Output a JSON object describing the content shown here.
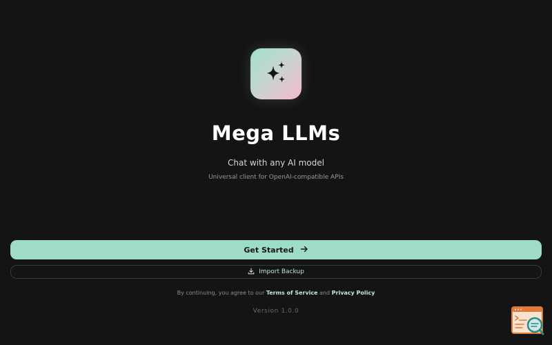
{
  "app": {
    "title": "Mega LLMs",
    "tagline": "Chat with any AI model",
    "subtagline": "Universal client for OpenAI-compatible APIs",
    "logo_icon": "sparkles-icon"
  },
  "actions": {
    "get_started_label": "Get Started",
    "get_started_icon": "arrow-right-icon",
    "import_backup_label": "Import Backup",
    "import_backup_icon": "download-icon"
  },
  "legal": {
    "prefix": "By continuing, you agree to our",
    "terms_label": "Terms of Service",
    "joiner": "and",
    "privacy_label": "Privacy Policy"
  },
  "footer": {
    "version": "Version 1.0.0"
  },
  "floating_widget": {
    "icon": "terminal-search-icon"
  },
  "colors": {
    "background": "#141414",
    "accent": "#9edcc8",
    "logo_gradient": [
      "#9fe0cb",
      "#f2bccb"
    ],
    "widget_orange": "#e07a3a",
    "widget_teal": "#2a8a8a"
  }
}
